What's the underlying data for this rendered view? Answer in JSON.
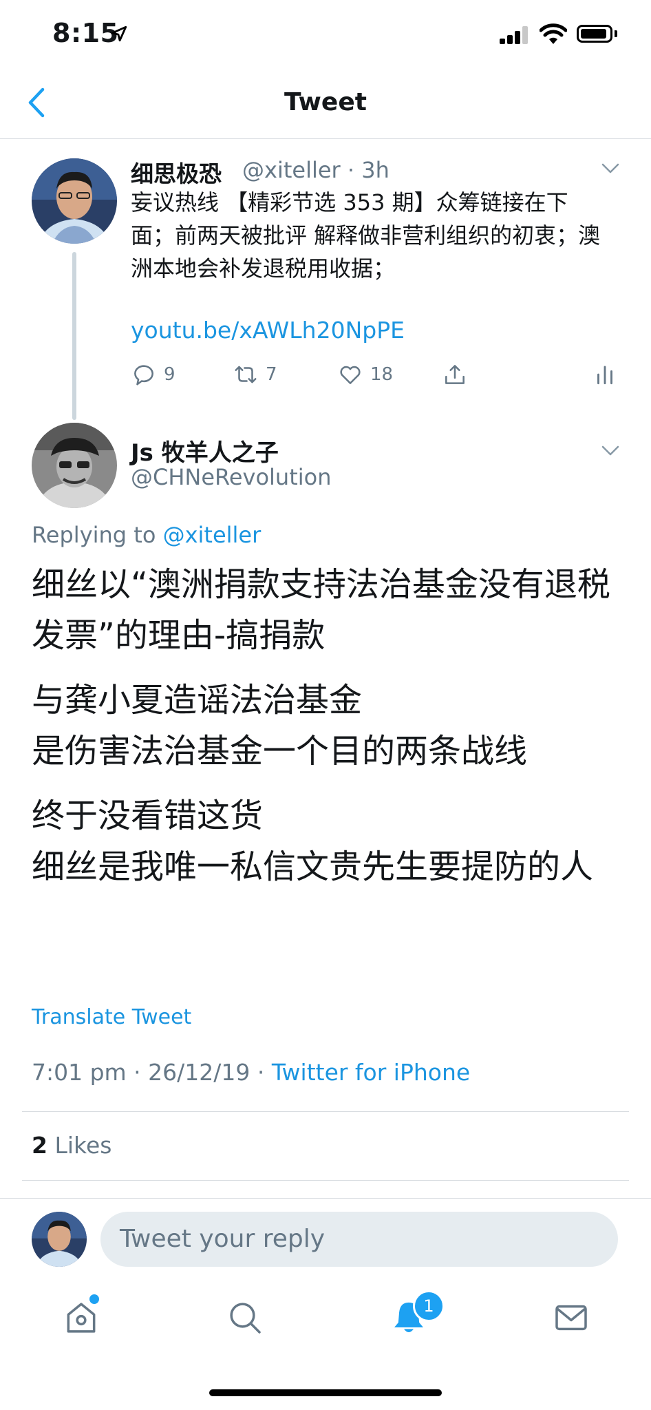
{
  "status_bar": {
    "time": "8:15"
  },
  "nav": {
    "title": "Tweet"
  },
  "parent_tweet": {
    "name": "细思极恐",
    "handle_time": "@xiteller · 3h",
    "text": "妄议热线 【精彩节选 353 期】众筹链接在下面；前两天被批评 解释做非营利组织的初衷；澳洲本地会补发退税用收据；",
    "link": "youtu.be/xAWLh20NpPE",
    "actions": {
      "replies": "9",
      "retweets": "7",
      "likes": "18"
    }
  },
  "main_tweet": {
    "name": "Js 牧羊人之子",
    "handle": "@CHNeRevolution",
    "replying_prefix": "Replying to",
    "replying_handle": "@xiteller",
    "paragraphs": [
      "细丝以“澳洲捐款支持法治基金没有退税发票”的理由-搞捐款",
      "与龚小夏造谣法治基金\n是伤害法治基金一个目的两条战线",
      "终于没看错这货\n细丝是我唯一私信文贵先生要提防的人"
    ],
    "translate": "Translate Tweet",
    "timestamp": "7:01 pm · 26/12/19 · ",
    "source": "Twitter for iPhone",
    "likes_count": "2",
    "likes_label": " Likes"
  },
  "reply_bar": {
    "placeholder": "Tweet your reply"
  },
  "tab_bar": {
    "tabs": [
      "home-icon",
      "search-icon",
      "notifications-icon",
      "messages-icon"
    ],
    "notification_badge": "1"
  },
  "colors": {
    "accent": "#1da1f2",
    "link": "#1b95e0",
    "muted": "#657786"
  }
}
